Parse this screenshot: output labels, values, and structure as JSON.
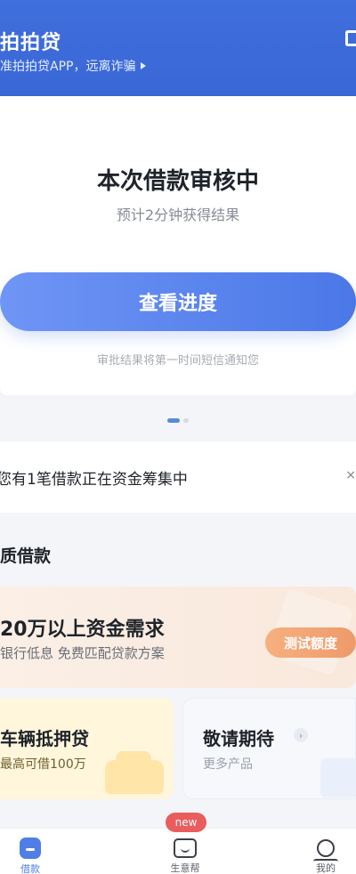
{
  "header": {
    "brand": "拍拍贷",
    "tagline": "准拍拍贷APP，远离诈骗",
    "accent": "#3f6fdc"
  },
  "review": {
    "title": "本次借款审核中",
    "subtitle": "预计2分钟获得结果",
    "button_label": "查看进度",
    "notice": "审批结果将第一时间短信通知您",
    "button_color": "#4b78e8"
  },
  "carousel": {
    "active_index": 1,
    "count": 2
  },
  "funding": {
    "text": "您有1笔借款正在资金筹集中",
    "close_icon": "close-icon"
  },
  "section": {
    "title": "质借款"
  },
  "promo": {
    "title": "20万以上资金需求",
    "subtitle": "银行低息 免费匹配贷款方案",
    "button_label": "测试额度",
    "button_color": "#ee9a6a"
  },
  "products": [
    {
      "title": "车辆抵押贷",
      "subtitle": "最高可借100万",
      "icon": "car-icon"
    },
    {
      "title": "敬请期待",
      "subtitle": "更多产品",
      "icon": "chevron-right-icon"
    }
  ],
  "tabbar": {
    "badge": "new",
    "tabs": [
      {
        "label": "借款",
        "icon": "home-icon",
        "active": true
      },
      {
        "label": "生意帮",
        "icon": "service-icon",
        "active": false
      },
      {
        "label": "我的",
        "icon": "user-icon",
        "active": false
      }
    ]
  }
}
